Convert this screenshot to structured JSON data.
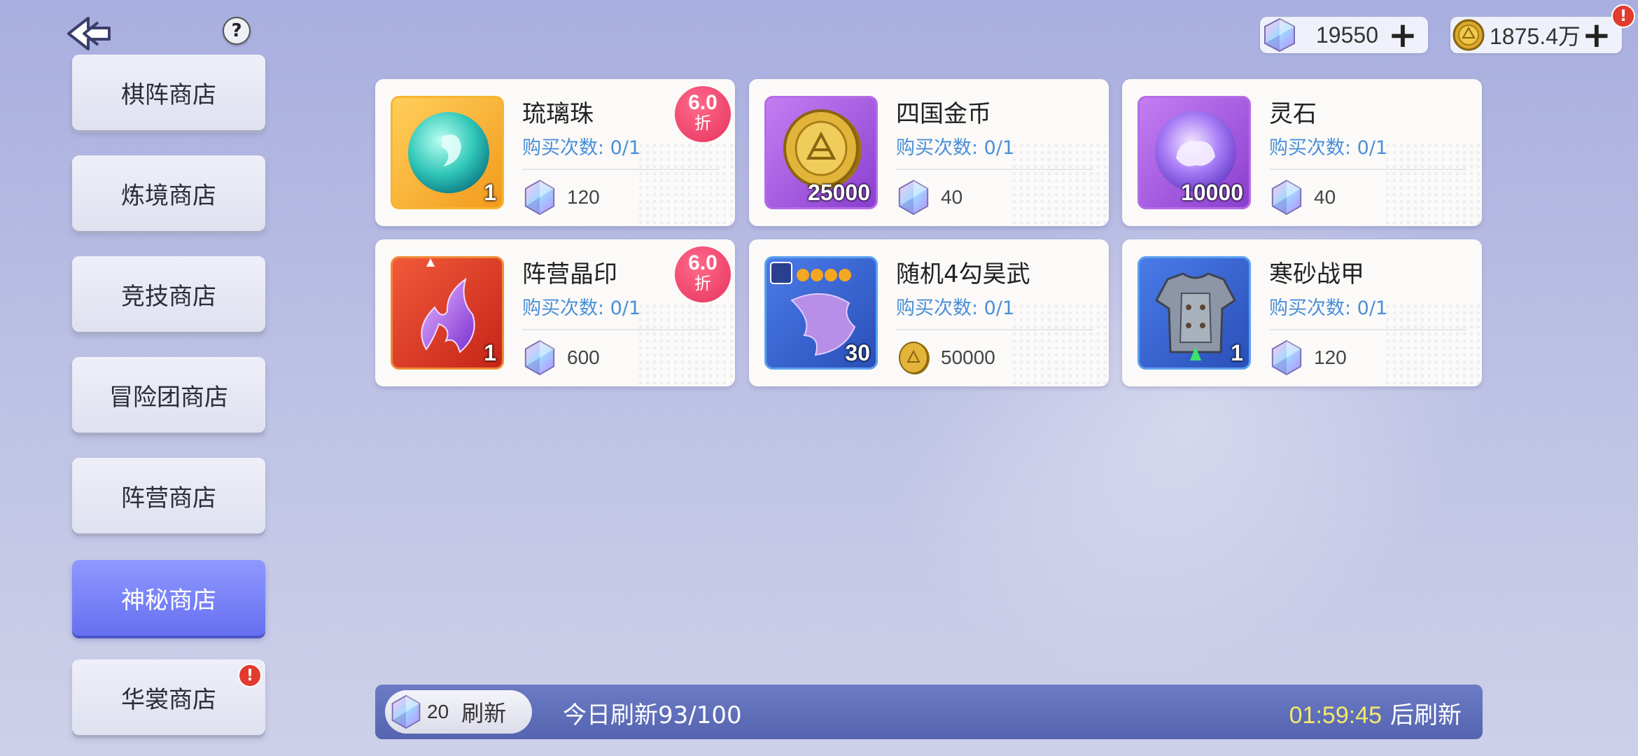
{
  "header": {
    "help_label": "?",
    "currency": [
      {
        "icon": "crystal-gem-icon",
        "value": "19550",
        "plus": "+"
      },
      {
        "icon": "gold-coin-icon",
        "value": "1875.4万",
        "plus": "+",
        "alert": "!"
      }
    ]
  },
  "sidebar": {
    "items": [
      {
        "label": "棋阵商店",
        "active": false
      },
      {
        "label": "炼境商店",
        "active": false
      },
      {
        "label": "竞技商店",
        "active": false
      },
      {
        "label": "冒险团商店",
        "active": false
      },
      {
        "label": "阵营商店",
        "active": false
      },
      {
        "label": "神秘商店",
        "active": true
      },
      {
        "label": "华裳商店",
        "active": false,
        "alert": "!"
      }
    ]
  },
  "shop": {
    "items": [
      {
        "name": "琉璃珠",
        "limit": "购买次数: 0/1",
        "qty": "1",
        "price": "120",
        "currency": "crystal-gem-icon",
        "discount": "6.0",
        "discount_unit": "折",
        "icon": "glass-bead-icon"
      },
      {
        "name": "四国金币",
        "limit": "购买次数: 0/1",
        "qty": "25000",
        "price": "40",
        "currency": "crystal-gem-icon",
        "icon": "four-kingdoms-coin-icon"
      },
      {
        "name": "灵石",
        "limit": "购买次数: 0/1",
        "qty": "10000",
        "price": "40",
        "currency": "crystal-gem-icon",
        "icon": "spirit-stone-icon"
      },
      {
        "name": "阵营晶印",
        "limit": "购买次数: 0/1",
        "qty": "1",
        "price": "600",
        "currency": "crystal-gem-icon",
        "discount": "6.0",
        "discount_unit": "折",
        "icon": "faction-seal-icon"
      },
      {
        "name": "随机4勾昊武",
        "limit": "购买次数: 0/1",
        "qty": "30",
        "price": "50000",
        "currency": "gold-coin-icon",
        "icon": "weapon-fragment-icon"
      },
      {
        "name": "寒砂战甲",
        "limit": "购买次数: 0/1",
        "qty": "1",
        "price": "120",
        "currency": "crystal-gem-icon",
        "icon": "armor-icon"
      }
    ]
  },
  "footer": {
    "refresh_cost": "20",
    "refresh_label": "刷新",
    "today_refresh": "今日刷新93/100",
    "timer": "01:59:45",
    "timer_suffix": "后刷新"
  },
  "colors": {
    "active_tab": "#7580f7",
    "limit_text": "#4a8fd9",
    "discount_badge": "#e6335e",
    "timer": "#f4e96a",
    "footer_bar": "#5e6cba"
  }
}
